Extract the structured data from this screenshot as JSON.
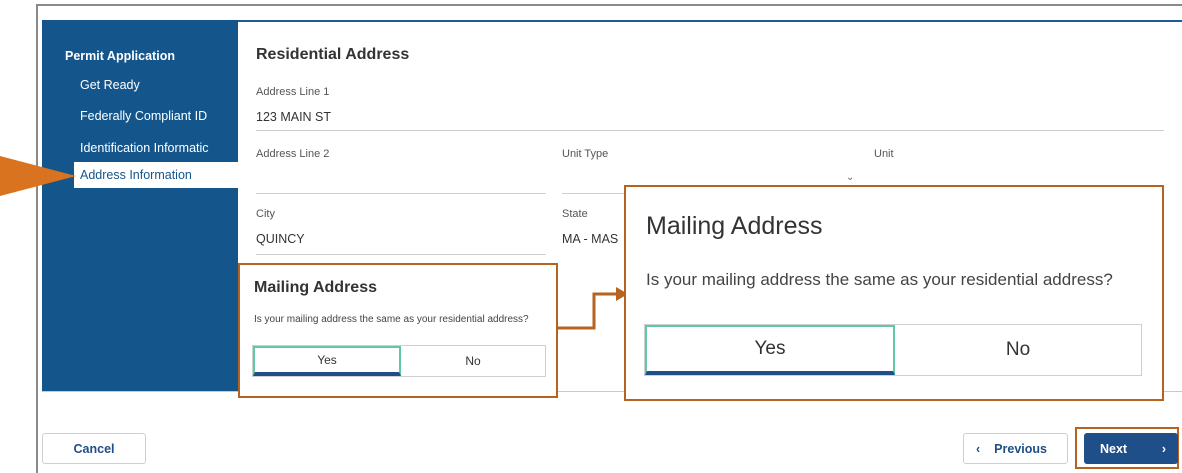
{
  "sidebar": {
    "title": "Permit Application",
    "items": [
      {
        "label": "Get Ready"
      },
      {
        "label": "Federally Compliant ID"
      },
      {
        "label": "Identification Informatic"
      },
      {
        "label": "Address Information"
      }
    ],
    "active_index": 3
  },
  "residential": {
    "title": "Residential Address",
    "address_line1_label": "Address Line 1",
    "address_line1_value": "123 MAIN ST",
    "address_line2_label": "Address Line 2",
    "address_line2_value": "",
    "unit_type_label": "Unit Type",
    "unit_type_value": "",
    "unit_label": "Unit",
    "unit_value": "",
    "city_label": "City",
    "city_value": "QUINCY",
    "state_label": "State",
    "state_value": "MA - MAS"
  },
  "mailing": {
    "title": "Mailing Address",
    "question": "Is your mailing address the same as your residential address?",
    "yes_label": "Yes",
    "no_label": "No",
    "selected": "Yes"
  },
  "footer": {
    "cancel_label": "Cancel",
    "previous_label": "Previous",
    "next_label": "Next"
  },
  "colors": {
    "sidebar_bg": "#14568c",
    "callout_border": "#b5631f",
    "selected_border": "#5fc8a5",
    "primary": "#1e4f88"
  },
  "icons": {
    "previous": "chevron-left-icon",
    "next": "chevron-right-icon",
    "dropdown": "chevron-down-icon",
    "pointer": "arrow-right-icon"
  }
}
